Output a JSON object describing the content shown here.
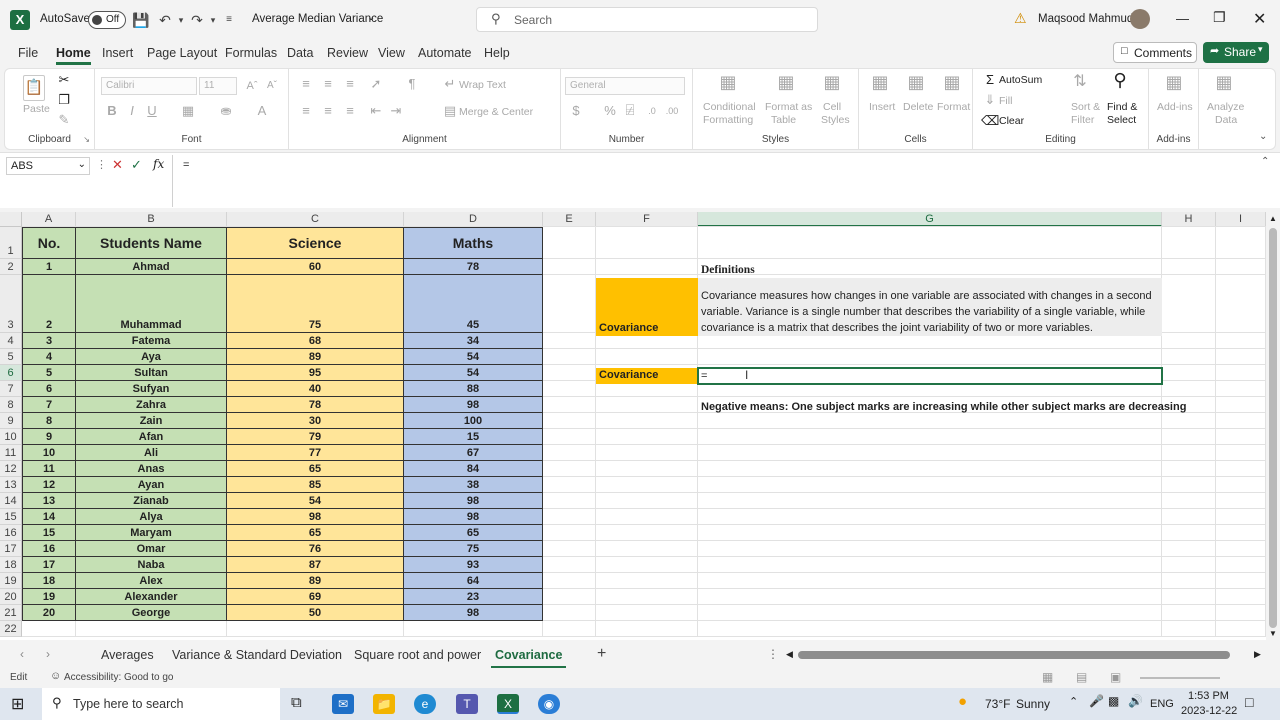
{
  "titlebar": {
    "autosave_label": "AutoSave",
    "autosave_state": "Off",
    "file_name": "Average Median Variance",
    "search_placeholder": "Search",
    "user_name": "Maqsood Mahmud"
  },
  "menu": [
    "File",
    "Home",
    "Insert",
    "Page Layout",
    "Formulas",
    "Data",
    "Review",
    "View",
    "Automate",
    "Help"
  ],
  "menu_active": "Home",
  "comments_label": "Comments",
  "share_label": "Share",
  "ribbon": {
    "clipboard": {
      "paste": "Paste",
      "label": "Clipboard"
    },
    "font": {
      "name": "Calibri",
      "size": "11",
      "label": "Font"
    },
    "alignment": {
      "wrap": "Wrap Text",
      "merge": "Merge & Center",
      "label": "Alignment"
    },
    "number": {
      "format": "General",
      "label": "Number"
    },
    "styles": {
      "cond1": "Conditional",
      "cond2": "Formatting",
      "fmt1": "Format as",
      "fmt2": "Table",
      "cell1": "Cell",
      "cell2": "Styles",
      "label": "Styles"
    },
    "cells": {
      "insert": "Insert",
      "delete": "Delete",
      "format": "Format",
      "label": "Cells"
    },
    "editing": {
      "autosum": "AutoSum",
      "fill": "Fill",
      "clear": "Clear",
      "sort1": "Sort &",
      "sort2": "Filter",
      "find1": "Find &",
      "find2": "Select",
      "label": "Editing"
    },
    "addins": {
      "addins1": "Add-ins",
      "label": "Add-ins"
    },
    "analyze": {
      "a1": "Analyze",
      "a2": "Data"
    }
  },
  "formula_bar": {
    "name_box": "ABS",
    "fx": "fx",
    "formula": "="
  },
  "columns": [
    "A",
    "B",
    "C",
    "D",
    "E",
    "F",
    "G",
    "H",
    "I"
  ],
  "table_headers": {
    "no": "No.",
    "name": "Students Name",
    "science": "Science",
    "maths": "Maths"
  },
  "rows": [
    {
      "r": "2",
      "no": "1",
      "name": "Ahmad",
      "sci": "60",
      "math": "78"
    },
    {
      "r": "3",
      "no": "2",
      "name": "Muhammad",
      "sci": "75",
      "math": "45"
    },
    {
      "r": "4",
      "no": "3",
      "name": "Fatema",
      "sci": "68",
      "math": "34"
    },
    {
      "r": "5",
      "no": "4",
      "name": "Aya",
      "sci": "89",
      "math": "54"
    },
    {
      "r": "6",
      "no": "5",
      "name": "Sultan",
      "sci": "95",
      "math": "54"
    },
    {
      "r": "7",
      "no": "6",
      "name": "Sufyan",
      "sci": "40",
      "math": "88"
    },
    {
      "r": "8",
      "no": "7",
      "name": "Zahra",
      "sci": "78",
      "math": "98"
    },
    {
      "r": "9",
      "no": "8",
      "name": "Zain",
      "sci": "30",
      "math": "100"
    },
    {
      "r": "10",
      "no": "9",
      "name": "Afan",
      "sci": "79",
      "math": "15"
    },
    {
      "r": "11",
      "no": "10",
      "name": "Ali",
      "sci": "77",
      "math": "67"
    },
    {
      "r": "12",
      "no": "11",
      "name": "Anas",
      "sci": "65",
      "math": "84"
    },
    {
      "r": "13",
      "no": "12",
      "name": "Ayan",
      "sci": "85",
      "math": "38"
    },
    {
      "r": "14",
      "no": "13",
      "name": "Zianab",
      "sci": "54",
      "math": "98"
    },
    {
      "r": "15",
      "no": "14",
      "name": "Alya",
      "sci": "98",
      "math": "98"
    },
    {
      "r": "16",
      "no": "15",
      "name": "Maryam",
      "sci": "65",
      "math": "65"
    },
    {
      "r": "17",
      "no": "16",
      "name": "Omar",
      "sci": "76",
      "math": "75"
    },
    {
      "r": "18",
      "no": "17",
      "name": "Naba",
      "sci": "87",
      "math": "93"
    },
    {
      "r": "19",
      "no": "18",
      "name": "Alex",
      "sci": "89",
      "math": "64"
    },
    {
      "r": "20",
      "no": "19",
      "name": "Alexander",
      "sci": "69",
      "math": "23"
    },
    {
      "r": "21",
      "no": "20",
      "name": "George",
      "sci": "50",
      "math": "98"
    }
  ],
  "side": {
    "definitions_title": "Definitions",
    "covariance_label": "Covariance",
    "definition_text": "Covariance measures how changes in one variable are associated with changes in a second variable. Variance is a single number that describes the variability of a single variable, while covariance is a matrix that describes the joint variability of two or more variables.",
    "covariance_label_2": "Covariance",
    "active_cell_value": "=",
    "negative_note": "Negative means: One subject marks are increasing while other subject marks are decreasing"
  },
  "sheet_tabs": [
    "Averages",
    "Variance & Standard Deviation",
    "Square root and power",
    "Covariance"
  ],
  "active_sheet": "Covariance",
  "status": {
    "mode": "Edit",
    "accessibility": "Accessibility: Good to go"
  },
  "taskbar": {
    "search_placeholder": "Type here to search",
    "weather_temp": "73°F",
    "weather_desc": "Sunny",
    "lang": "ENG",
    "time": "1:53 PM",
    "date": "2023-12-22"
  },
  "colors": {
    "accent": "#217346",
    "green_fill": "#c5e0b4",
    "yellow_fill": "#ffe599",
    "blue_fill": "#b4c7e7",
    "orange_fill": "#ffc000"
  }
}
